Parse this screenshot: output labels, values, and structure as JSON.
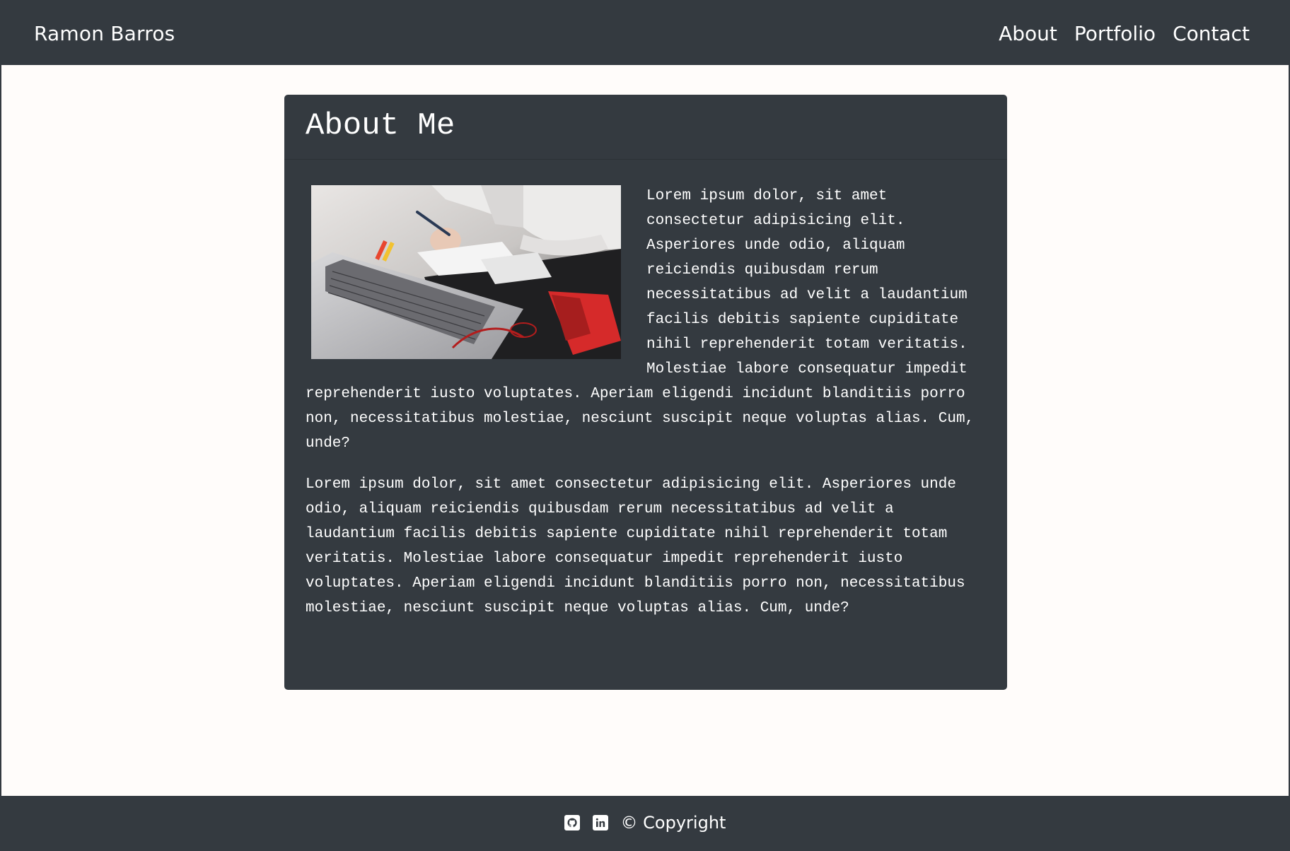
{
  "navbar": {
    "brand": "Ramon Barros",
    "links": [
      "About",
      "Portfolio",
      "Contact"
    ]
  },
  "card": {
    "title": "About Me",
    "image": "laptop-desk-photo",
    "paragraphs": [
      "Lorem ipsum dolor, sit amet consectetur adipisicing elit. Asperiores unde odio, aliquam reiciendis quibusdam rerum necessitatibus ad velit a laudantium facilis debitis sapiente cupiditate nihil reprehenderit totam veritatis. Molestiae labore consequatur impedit reprehenderit iusto voluptates. Aperiam eligendi incidunt blanditiis porro non, necessitatibus molestiae, nesciunt suscipit neque voluptas alias. Cum, unde?",
      "Lorem ipsum dolor, sit amet consectetur adipisicing elit. Asperiores unde odio, aliquam reiciendis quibusdam rerum necessitatibus ad velit a laudantium facilis debitis sapiente cupiditate nihil reprehenderit totam veritatis. Molestiae labore consequatur impedit reprehenderit iusto voluptates. Aperiam eligendi incidunt blanditiis porro non, necessitatibus molestiae, nesciunt suscipit neque voluptas alias. Cum, unde?"
    ]
  },
  "footer": {
    "icons": [
      "github-icon",
      "linkedin-icon"
    ],
    "copyright": "© Copyright"
  },
  "colors": {
    "dark": "#343a40",
    "background": "#fffcfa",
    "text": "#ffffff"
  }
}
